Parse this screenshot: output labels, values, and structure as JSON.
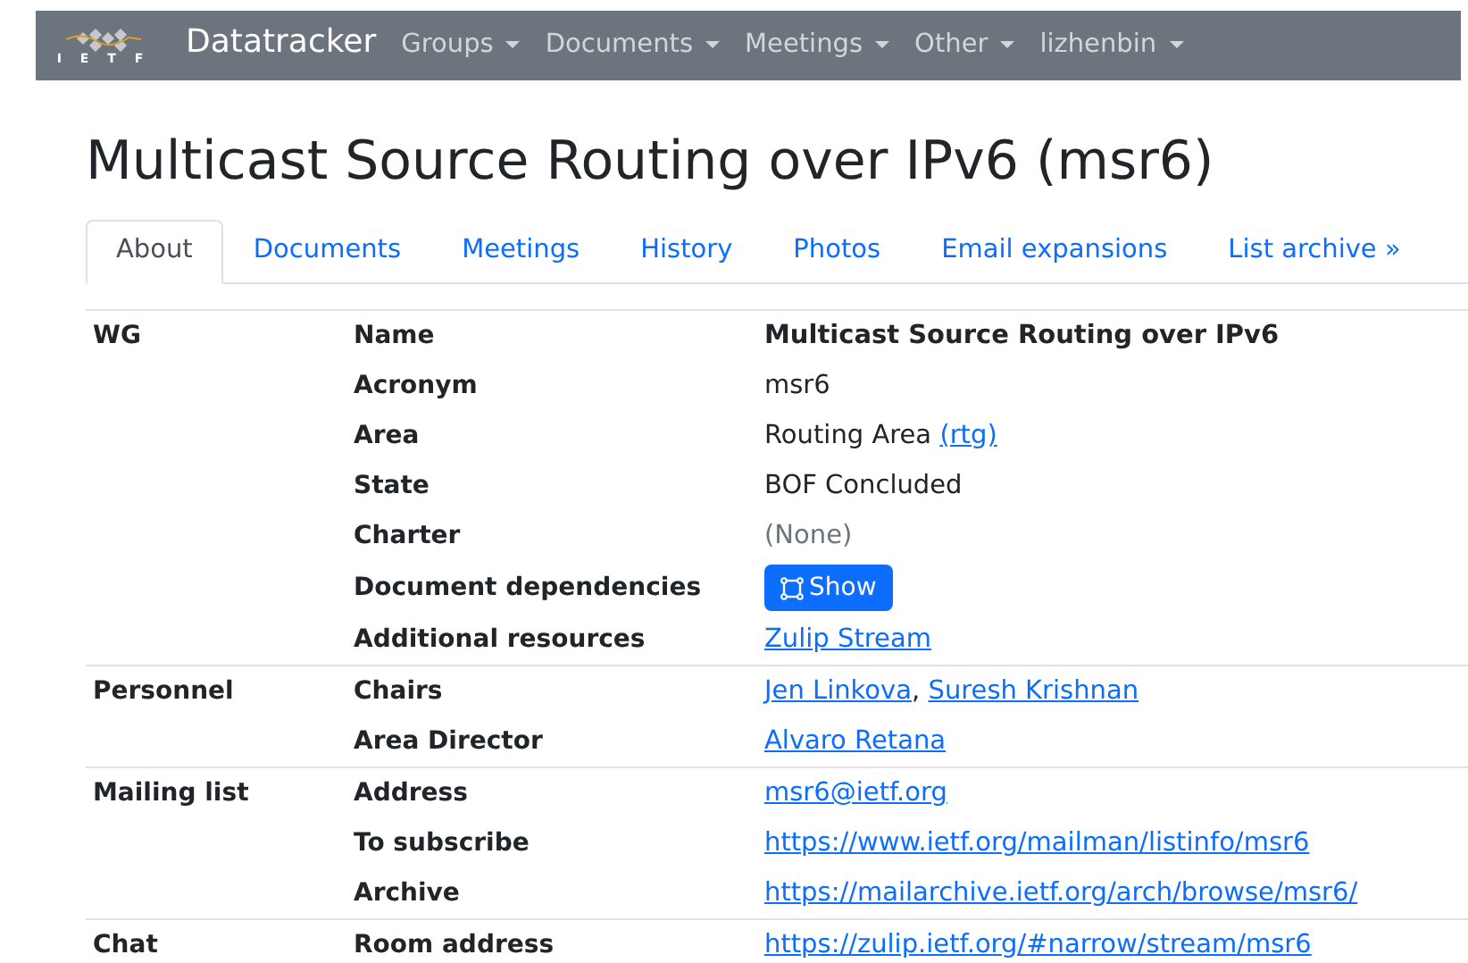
{
  "navbar": {
    "brand": "Datatracker",
    "logo_text": "I E T F",
    "menus": [
      "Groups",
      "Documents",
      "Meetings",
      "Other",
      "lizhenbin"
    ]
  },
  "title": "Multicast Source Routing over IPv6 (msr6)",
  "tabs": [
    {
      "label": "About",
      "selected": true
    },
    {
      "label": "Documents",
      "selected": false
    },
    {
      "label": "Meetings",
      "selected": false
    },
    {
      "label": "History",
      "selected": false
    },
    {
      "label": "Photos",
      "selected": false
    },
    {
      "label": "Email expansions",
      "selected": false
    },
    {
      "label": "List archive »",
      "selected": false
    }
  ],
  "sections": [
    {
      "heading": "WG",
      "rows": [
        {
          "label": "Name",
          "kind": "bold",
          "parts": [
            {
              "text": "Multicast Source Routing over IPv6",
              "kind": "plain"
            }
          ]
        },
        {
          "label": "Acronym",
          "kind": "text",
          "parts": [
            {
              "text": "msr6",
              "kind": "plain"
            }
          ]
        },
        {
          "label": "Area",
          "kind": "text",
          "parts": [
            {
              "text": "Routing Area ",
              "kind": "plain"
            },
            {
              "text": "(rtg)",
              "kind": "link"
            }
          ]
        },
        {
          "label": "State",
          "kind": "text",
          "parts": [
            {
              "text": "BOF Concluded",
              "kind": "plain"
            }
          ]
        },
        {
          "label": "Charter",
          "kind": "muted",
          "parts": [
            {
              "text": "(None)",
              "kind": "plain"
            }
          ]
        },
        {
          "label": "Document dependencies",
          "kind": "button",
          "value": "Show"
        },
        {
          "label": "Additional resources",
          "kind": "text",
          "parts": [
            {
              "text": "Zulip Stream",
              "kind": "link"
            }
          ]
        }
      ]
    },
    {
      "heading": "Personnel",
      "rows": [
        {
          "label": "Chairs",
          "kind": "text",
          "parts": [
            {
              "text": "Jen Linkova",
              "kind": "link"
            },
            {
              "text": ", ",
              "kind": "plain"
            },
            {
              "text": "Suresh Krishnan",
              "kind": "link"
            }
          ]
        },
        {
          "label": "Area Director",
          "kind": "text",
          "parts": [
            {
              "text": "Alvaro Retana",
              "kind": "link"
            }
          ]
        }
      ]
    },
    {
      "heading": "Mailing list",
      "rows": [
        {
          "label": "Address",
          "kind": "text",
          "parts": [
            {
              "text": "msr6@ietf.org",
              "kind": "link"
            }
          ]
        },
        {
          "label": "To subscribe",
          "kind": "text",
          "parts": [
            {
              "text": "https://www.ietf.org/mailman/listinfo/msr6",
              "kind": "link"
            }
          ]
        },
        {
          "label": "Archive",
          "kind": "text",
          "parts": [
            {
              "text": "https://mailarchive.ietf.org/arch/browse/msr6/",
              "kind": "link"
            }
          ]
        }
      ]
    },
    {
      "heading": "Chat",
      "rows": [
        {
          "label": "Room address",
          "kind": "text",
          "parts": [
            {
              "text": "https://zulip.ietf.org/#narrow/stream/msr6",
              "kind": "link"
            }
          ]
        }
      ]
    }
  ]
}
